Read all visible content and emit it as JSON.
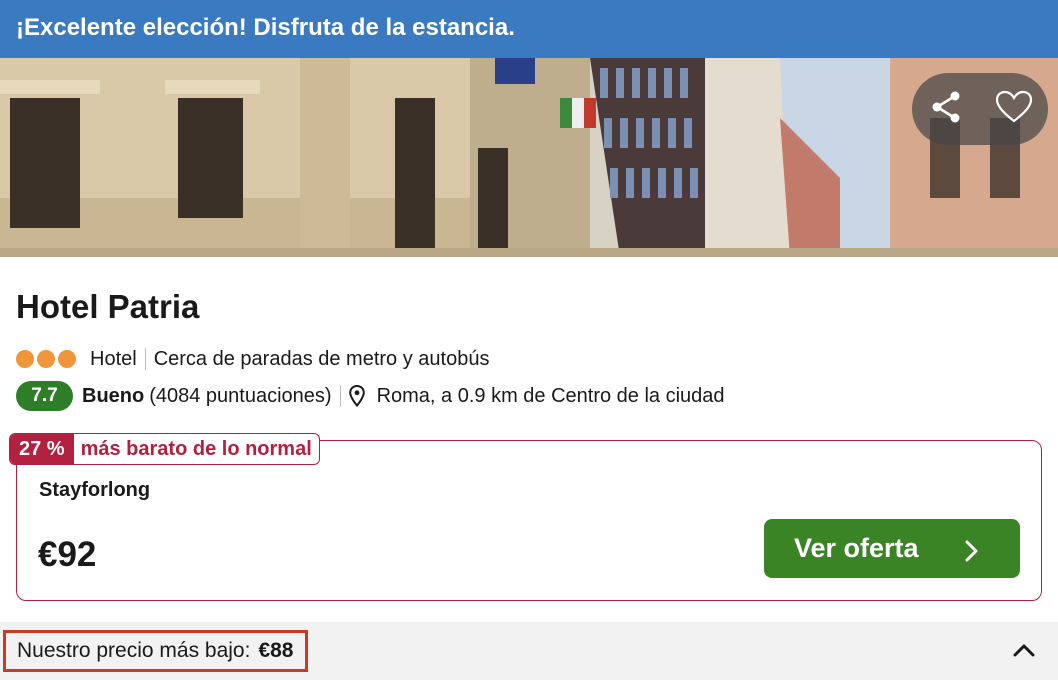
{
  "banner": {
    "text": "¡Excelente elección! Disfruta de la estancia."
  },
  "hero": {
    "image_alt": "hotel exterior street photo",
    "actions": {
      "share_icon": "share-icon",
      "favorite_icon": "heart-icon"
    }
  },
  "hotel": {
    "name": "Hotel Patria",
    "stars": 3,
    "type": "Hotel",
    "highlight": "Cerca de paradas de metro y autobús",
    "score": "7.7",
    "rating_word": "Bueno",
    "reviews": "(4084 puntuaciones)",
    "location": "Roma, a 0.9 km de Centro de la ciudad"
  },
  "deal": {
    "discount": "27 %",
    "discount_text": "más barato de lo normal",
    "provider": "Stayforlong",
    "price": "€92",
    "cta": "Ver oferta"
  },
  "footer": {
    "lowest_label": "Nuestro precio más bajo:",
    "lowest_price": "€88"
  },
  "colors": {
    "banner": "#3a7ac0",
    "score": "#2e7d27",
    "deal_accent": "#b32140",
    "cta": "#3a8426",
    "highlight_box": "#cc3a22",
    "stars": "#f0963a"
  }
}
